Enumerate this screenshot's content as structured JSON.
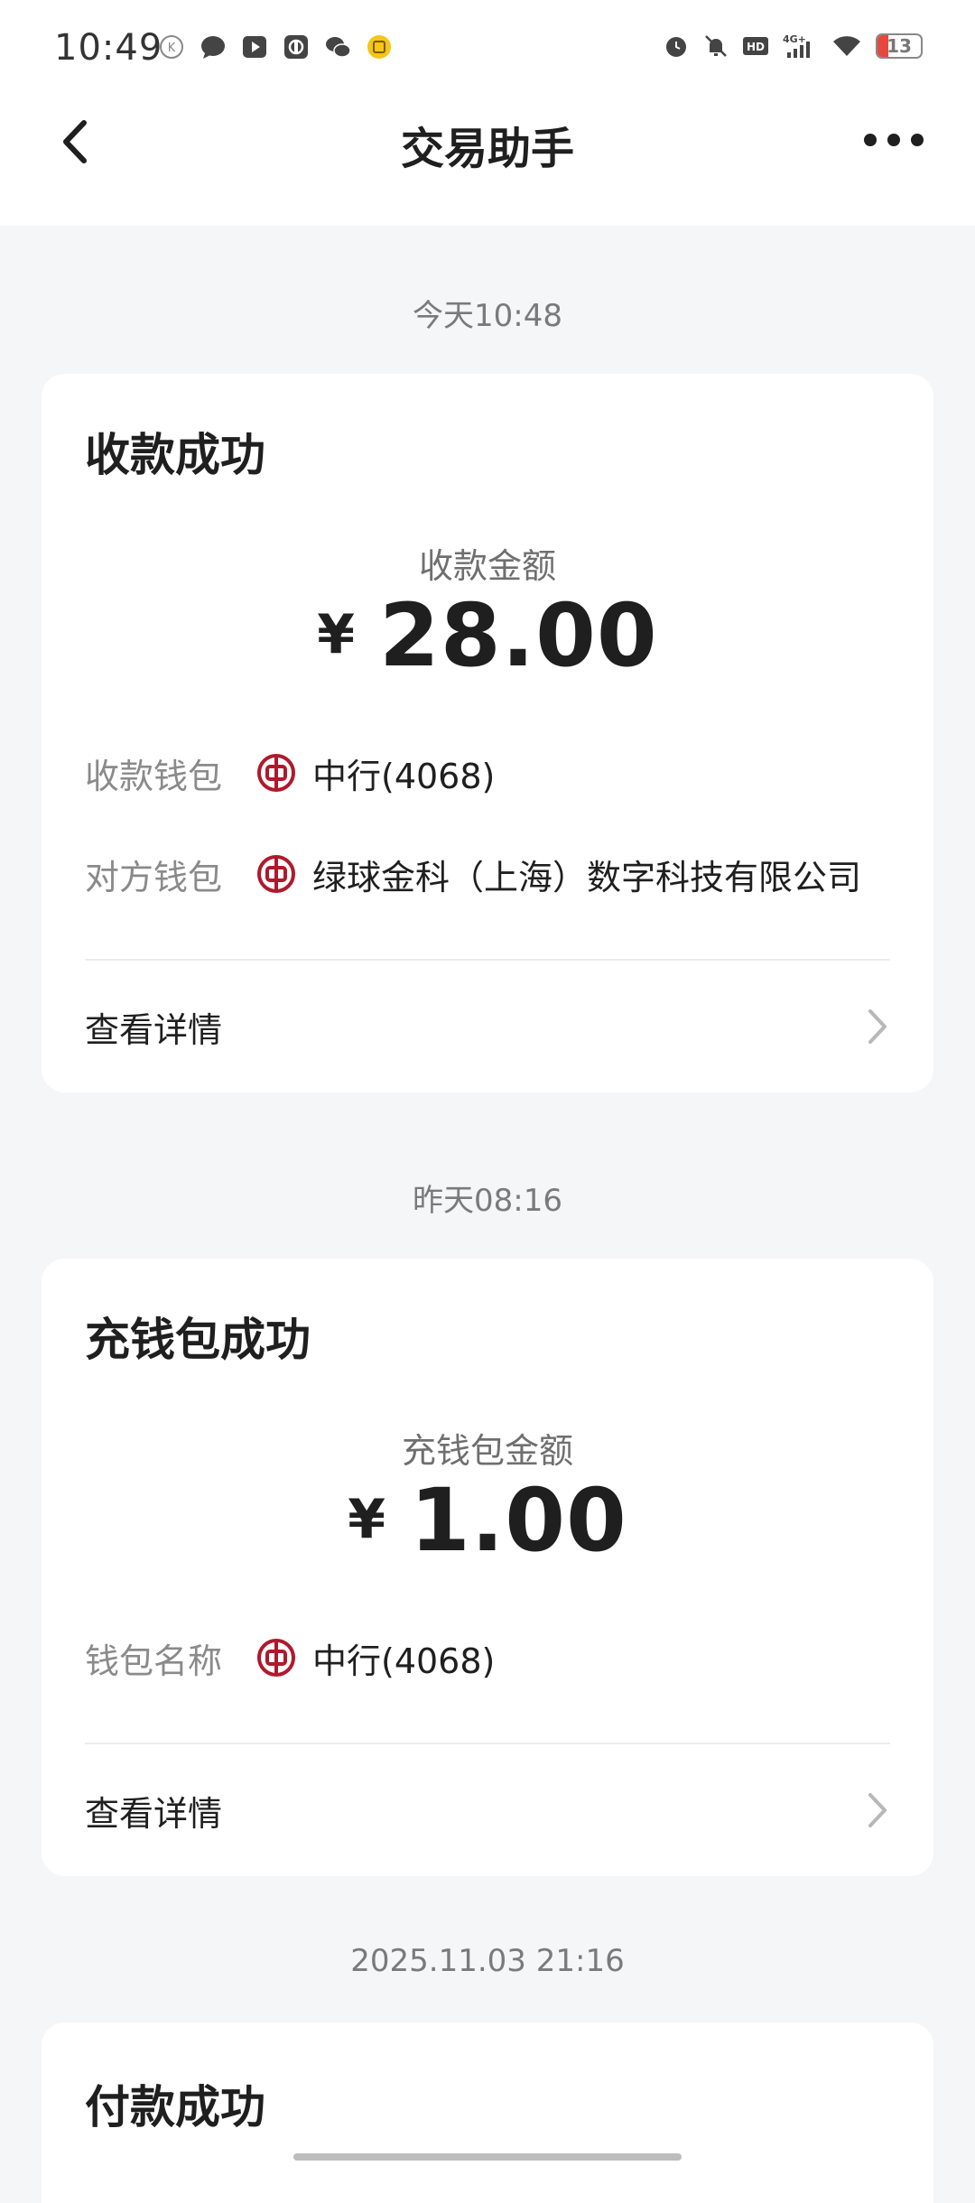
{
  "status_bar": {
    "time": "10:49",
    "battery_level": "13",
    "network": "4G+",
    "left_icons": [
      "k-app-icon",
      "message-bubble-icon",
      "video-play-icon",
      "app-icon",
      "wechat-icon",
      "yellow-app-icon"
    ],
    "right_icons": [
      "alarm-icon",
      "mute-bell-icon",
      "hd-icon",
      "signal-4g-icon",
      "wifi-icon",
      "battery-icon"
    ]
  },
  "header": {
    "title": "交易助手"
  },
  "transactions": [
    {
      "timestamp": "今天10:48",
      "title": "收款成功",
      "amount_label": "收款金额",
      "currency": "¥",
      "amount": "28.00",
      "rows": [
        {
          "label": "收款钱包",
          "value": "中行(4068)"
        },
        {
          "label": "对方钱包",
          "value": "绿球金科（上海）数字科技有限公司"
        }
      ],
      "detail_label": "查看详情"
    },
    {
      "timestamp": "昨天08:16",
      "title": "充钱包成功",
      "amount_label": "充钱包金额",
      "currency": "¥",
      "amount": "1.00",
      "rows": [
        {
          "label": "钱包名称",
          "value": "中行(4068)"
        }
      ],
      "detail_label": "查看详情"
    },
    {
      "timestamp": "2025.11.03 21:16",
      "title": "付款成功"
    }
  ],
  "colors": {
    "background": "#f5f6f8",
    "card": "#ffffff",
    "bank_logo": "#b0192c",
    "battery_low": "#e5483d"
  }
}
